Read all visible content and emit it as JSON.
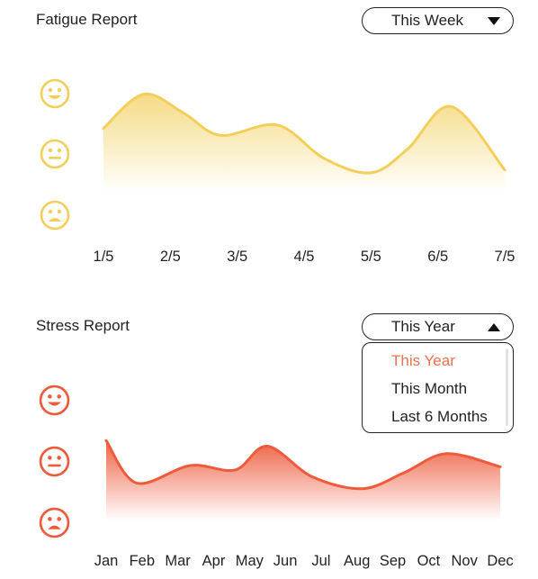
{
  "fatigue": {
    "title": "Fatigue Report",
    "dropdown": {
      "selected": "This Week",
      "open": false
    },
    "color": "#f2cf5b",
    "levels": [
      "happy",
      "neutral",
      "sad"
    ],
    "chart_data": {
      "type": "area",
      "categories": [
        "1/5",
        "2/5",
        "3/5",
        "4/5",
        "5/5",
        "6/5",
        "7/5"
      ],
      "x": [
        1,
        2,
        3,
        4,
        5,
        6,
        7
      ],
      "series": [
        {
          "points": [
            [
              1.0,
              1.35
            ],
            [
              1.6,
              2.18
            ],
            [
              2.2,
              1.72
            ],
            [
              2.75,
              1.18
            ],
            [
              3.6,
              1.43
            ],
            [
              4.3,
              0.62
            ],
            [
              5.0,
              0.27
            ],
            [
              5.55,
              0.85
            ],
            [
              6.2,
              1.88
            ],
            [
              7.0,
              0.34
            ]
          ]
        }
      ],
      "ylim": [
        -0.3,
        2.5
      ]
    }
  },
  "stress": {
    "title": "Stress Report",
    "dropdown": {
      "selected": "This Year",
      "open": true,
      "options": [
        "This Year",
        "This Month",
        "Last 6 Months"
      ]
    },
    "color": "#ee5b3c",
    "levels": [
      "happy",
      "neutral",
      "sad"
    ],
    "chart_data": {
      "type": "area",
      "categories": [
        "Jan",
        "Feb",
        "Mar",
        "Apr",
        "May",
        "Jun",
        "Jul",
        "Aug",
        "Sep",
        "Oct",
        "Nov",
        "Dec"
      ],
      "x": [
        1,
        2,
        3,
        4,
        5,
        6,
        7,
        8,
        9,
        10,
        11,
        12
      ],
      "series": [
        {
          "points": [
            [
              1.0,
              1.15
            ],
            [
              1.85,
              0.47
            ],
            [
              3.35,
              0.75
            ],
            [
              4.6,
              0.68
            ],
            [
              5.5,
              1.06
            ],
            [
              6.75,
              0.57
            ],
            [
              8.15,
              0.38
            ],
            [
              9.3,
              0.63
            ],
            [
              10.5,
              0.94
            ],
            [
              12.0,
              0.73
            ]
          ]
        }
      ],
      "ylim": [
        0.0,
        1.5
      ]
    }
  }
}
